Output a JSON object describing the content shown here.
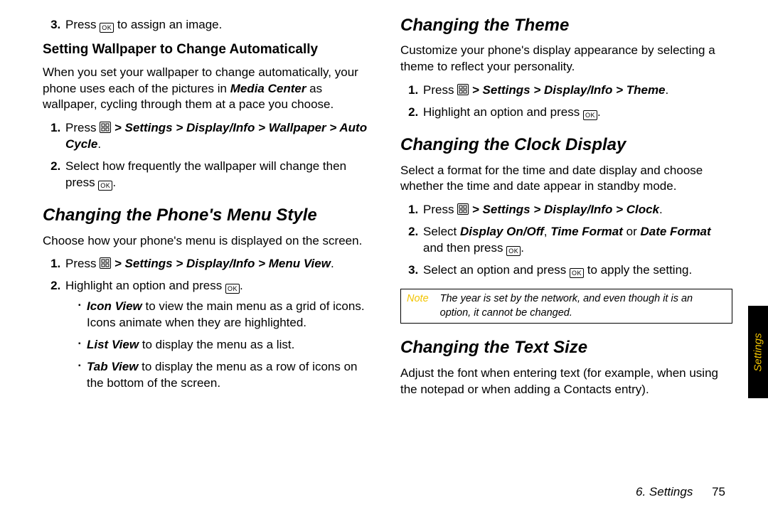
{
  "keys": {
    "ok": "OK"
  },
  "left": {
    "step3_a": "Press ",
    "step3_b": " to assign an image.",
    "sub1_title": "Setting Wallpaper to Change Automatically",
    "sub1_para": "When you set your wallpaper to change automatically, your phone uses each of the pictures in ",
    "sub1_para_b": "Media Center",
    "sub1_para_c": " as wallpaper, cycling through them at a pace you choose.",
    "sub1_s1_a": "Press ",
    "sub1_s1_path": " > Settings > Display/Info > Wallpaper > Auto Cycle",
    "sub1_s1_dot": ".",
    "sub1_s2_a": "Select how frequently the wallpaper will change then press ",
    "sub1_s2_b": ".",
    "h2a": "Changing the Phone's Menu Style",
    "h2a_para": "Choose how your phone's menu is displayed on the screen.",
    "h2a_s1_a": "Press ",
    "h2a_s1_path": " > Settings > Display/Info > Menu View",
    "h2a_s1_dot": ".",
    "h2a_s2_a": "Highlight an option and press ",
    "h2a_s2_b": ".",
    "bul1_b": "Icon View",
    "bul1_t": " to view the main menu as a grid of icons. Icons animate when they are highlighted.",
    "bul2_b": "List View",
    "bul2_t": " to display the menu as a list.",
    "bul3_b": "Tab View",
    "bul3_t": " to display the menu as a row of icons on the bottom of the screen."
  },
  "right": {
    "h2b": "Changing the Theme",
    "h2b_para": "Customize your phone's display appearance by selecting a theme to reflect your personality.",
    "h2b_s1_a": "Press ",
    "h2b_s1_path": " > Settings > Display/Info > Theme",
    "h2b_s1_dot": ".",
    "h2b_s2_a": "Highlight an option and press ",
    "h2b_s2_b": ".",
    "h2c": "Changing the Clock Display",
    "h2c_para": "Select a format for the time and date display and choose whether the time and date appear in standby mode.",
    "h2c_s1_a": "Press ",
    "h2c_s1_path": " > Settings > Display/Info > Clock",
    "h2c_s1_dot": ".",
    "h2c_s2_a": "Select ",
    "h2c_s2_b1": "Display On/Off",
    "h2c_s2_c1": ", ",
    "h2c_s2_b2": "Time Format",
    "h2c_s2_c2": " or ",
    "h2c_s2_b3": "Date Format",
    "h2c_s2_c3": " and then press ",
    "h2c_s2_d": ".",
    "h2c_s3_a": "Select an option and press ",
    "h2c_s3_b": " to apply the setting.",
    "note_label": "Note",
    "note_body": "The year is set by the network, and even though it is an option, it cannot be changed.",
    "h2d": "Changing the Text Size",
    "h2d_para": "Adjust the font when entering text (for example, when using the notepad or when adding a Contacts entry)."
  },
  "footer": {
    "chapter": "6. Settings",
    "page": "75"
  },
  "sidetab": "Settings"
}
